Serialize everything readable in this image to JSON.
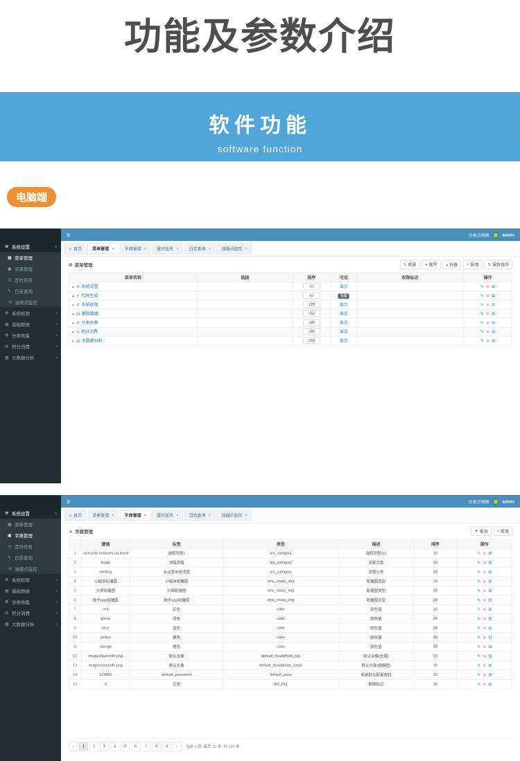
{
  "page": {
    "title": "功能及参数介绍",
    "banner": {
      "title": "软件功能",
      "subtitle": "software function"
    },
    "device_badge": "电脑端"
  },
  "colors": {
    "banner_bg": "#52a5d8",
    "badge_bg": "#ee8f35",
    "topbar_bg": "#4a90be",
    "sidebar_bg": "#222d32",
    "link_blue": "#337ab7",
    "edit_green": "#00a65a",
    "delete_red": "#e08e87",
    "add_blue": "#3c8dbc"
  },
  "admin": {
    "topbar": {
      "menu_toggle_glyph": "≡",
      "map_link": "分类点地图",
      "username": "admin"
    },
    "tab_close_glyph": "×",
    "sidebar": {
      "items": [
        {
          "label": "系统设置",
          "icon": "wrench-icon",
          "glyph": "⚒",
          "type": "open",
          "chevron": "∨"
        },
        {
          "label": "菜单管理",
          "icon": "menu-grid-icon",
          "glyph": "▦",
          "type": "sub"
        },
        {
          "label": "字典管理",
          "icon": "book-icon",
          "glyph": "▣",
          "type": "sub"
        },
        {
          "label": "定时任务",
          "icon": "clock-icon",
          "glyph": "◷",
          "type": "sub"
        },
        {
          "label": "日志查询",
          "icon": "log-pencil-icon",
          "glyph": "✎",
          "type": "sub"
        },
        {
          "label": "油烟点监控",
          "icon": "monitor-icon",
          "glyph": "☏",
          "type": "sub"
        },
        {
          "label": "系统权限",
          "icon": "gear-icon",
          "glyph": "⚙",
          "type": "top",
          "chevron": "‹"
        },
        {
          "label": "基础数据",
          "icon": "database-icon",
          "glyph": "▤",
          "type": "top",
          "chevron": "‹"
        },
        {
          "label": "分类收集",
          "icon": "recycle-icon",
          "glyph": "♻",
          "type": "top",
          "chevron": "‹"
        },
        {
          "label": "积分消费",
          "icon": "points-icon",
          "glyph": "⊟",
          "type": "top",
          "chevron": "‹"
        },
        {
          "label": "大数据分析",
          "icon": "chart-icon",
          "glyph": "▧",
          "type": "top",
          "chevron": "‹"
        }
      ]
    },
    "tabs": [
      {
        "label": "首页",
        "glyph": "⌂",
        "closable": false
      },
      {
        "label": "菜单管理",
        "closable": true
      },
      {
        "label": "字典管理",
        "closable": true
      },
      {
        "label": "定时任务",
        "closable": true
      },
      {
        "label": "日志查询",
        "closable": true
      },
      {
        "label": "油烟点监控",
        "closable": true
      }
    ]
  },
  "row_actions": [
    {
      "name": "edit",
      "glyph": "✎",
      "color": "#00a65a"
    },
    {
      "name": "delete",
      "glyph": "⊗",
      "color": "#e08e87"
    },
    {
      "name": "add-child",
      "glyph": "⊞",
      "color": "#3c8dbc"
    }
  ],
  "panel_menu": {
    "active_tab": "菜单管理",
    "active_sidebar": "菜单管理",
    "section_glyph": "▦",
    "section_title": "菜单管理",
    "caret_glyph": "▸",
    "toolbar": [
      {
        "label": "刷新",
        "glyph": "↻"
      },
      {
        "label": "展开",
        "glyph": "▾"
      },
      {
        "label": "折叠",
        "glyph": "▴"
      },
      {
        "label": "新增",
        "glyph": "+"
      },
      {
        "label": "保存排序",
        "glyph": "⇅"
      }
    ],
    "table": {
      "headers": [
        "菜单名称",
        "链接",
        "排序",
        "可见",
        "权限标识",
        "操作"
      ],
      "rows": [
        {
          "name": "系统设置",
          "glyph": "⚒",
          "link": "",
          "sort": "30",
          "visible": "显示",
          "permission": ""
        },
        {
          "name": "代码生成",
          "glyph": "✦",
          "link": "",
          "sort": "60",
          "visible": "隐藏",
          "permission": ""
        },
        {
          "name": "系统权限",
          "glyph": "⚙",
          "link": "",
          "sort": "120",
          "visible": "显示",
          "permission": ""
        },
        {
          "name": "基础数据",
          "glyph": "▤",
          "link": "",
          "sort": "150",
          "visible": "显示",
          "permission": ""
        },
        {
          "name": "分类收集",
          "glyph": "♻",
          "link": "",
          "sort": "180",
          "visible": "显示",
          "permission": ""
        },
        {
          "name": "积分消费",
          "glyph": "⊟",
          "link": "",
          "sort": "180",
          "visible": "显示",
          "permission": ""
        },
        {
          "name": "大数据分析",
          "glyph": "▧",
          "link": "",
          "sort": "240",
          "visible": "显示",
          "permission": ""
        }
      ]
    }
  },
  "panel_dict": {
    "active_tab": "字典管理",
    "active_sidebar": "字典管理",
    "section_glyph": "▲",
    "section_title": "字典管理",
    "toolbar": [
      {
        "label": "查询",
        "glyph": "▼"
      },
      {
        "label": "新增",
        "glyph": "+"
      }
    ],
    "table": {
      "headers": [
        "",
        "键值",
        "标签",
        "类型",
        "描述",
        "排序",
        "操作"
      ],
      "rows": [
        [
          "1",
          "com.jsite.modules.oa.leave",
          "请假流程1",
          "act_category",
          "请假流程111",
          "10"
        ],
        [
          "2",
          "leave",
          "请假流程",
          "act_category",
          "流程分类",
          "10"
        ],
        [
          "3",
          "metting",
          "会议室申请流程",
          "act_category",
          "流程分类",
          "20"
        ],
        [
          "4",
          "小程序轮播图",
          "小程序轮播图",
          "cms_rotary_img",
          "轮播图类型",
          "10"
        ],
        [
          "5",
          "大屏轮播图",
          "大屏轮播图",
          "cms_rotary_img",
          "轮播图类型",
          "20"
        ],
        [
          "6",
          "助手app轮播图",
          "助手app轮播图",
          "cms_rotary_img",
          "轮播图类型",
          "30"
        ],
        [
          "7",
          "red",
          "红色",
          "color",
          "颜色值",
          "10"
        ],
        [
          "8",
          "green",
          "绿色",
          "color",
          "颜色值",
          "20"
        ],
        [
          "9",
          "blue",
          "蓝色",
          "color",
          "颜色值",
          "30"
        ],
        [
          "10",
          "yellow",
          "黄色",
          "color",
          "颜色值",
          "40"
        ],
        [
          "11",
          "orange",
          "橙色",
          "color",
          "颜色值",
          "50"
        ],
        [
          "12",
          "images/userinfo.png",
          "默认头像",
          "default_headphoto_big",
          "默认头像(大图)",
          "10"
        ],
        [
          "13",
          "images/userinfo.png",
          "默认头像",
          "default_headphoto_small",
          "默认头像(缩略图)",
          "10"
        ],
        [
          "14",
          "123456",
          "default_password",
          "default_pass",
          "系统默认配置密码",
          "10"
        ],
        [
          "15",
          "0",
          "正常",
          "del_flag",
          "删除标记",
          "10"
        ]
      ]
    },
    "pagination": {
      "prev_glyph": "‹",
      "next_glyph": "›",
      "pages": [
        "1",
        "2",
        "3",
        "4",
        "5",
        "6",
        "7",
        "8",
        "9"
      ],
      "active_page": "1",
      "info": "当前 1 页, 每页 15 条, 共 125 条"
    }
  }
}
